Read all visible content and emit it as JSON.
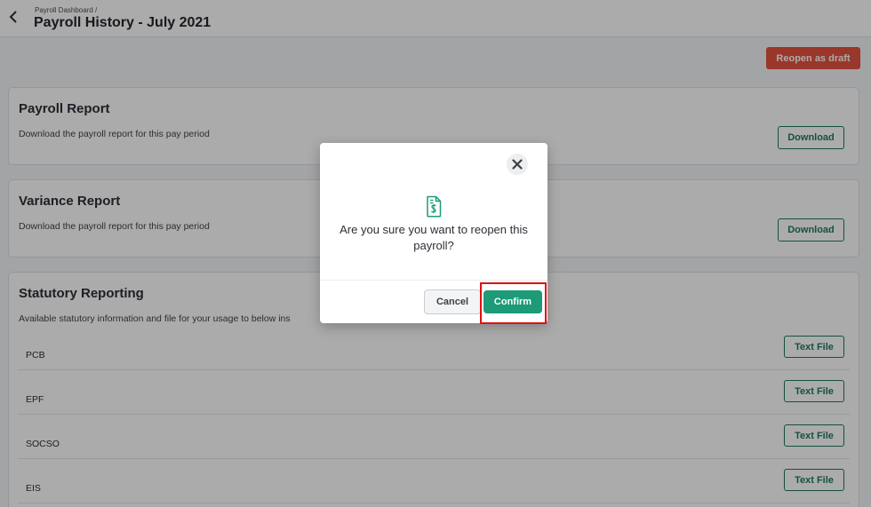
{
  "header": {
    "breadcrumb": "Payroll Dashboard /",
    "title": "Payroll History - July 2021"
  },
  "actions": {
    "reopen_label": "Reopen as draft"
  },
  "cards": {
    "payroll_report": {
      "title": "Payroll Report",
      "description": "Download the payroll report for this pay period",
      "button_label": "Download"
    },
    "variance_report": {
      "title": "Variance Report",
      "description": "Download the payroll report for this pay period",
      "button_label": "Download"
    },
    "statutory": {
      "title": "Statutory Reporting",
      "description": "Available statutory information and file for your usage to below ins",
      "rows": [
        {
          "label": "PCB",
          "button_label": "Text File"
        },
        {
          "label": "EPF",
          "button_label": "Text File"
        },
        {
          "label": "SOCSO",
          "button_label": "Text File"
        },
        {
          "label": "EIS",
          "button_label": "Text File"
        }
      ]
    }
  },
  "modal": {
    "message": "Are you sure you want to reopen this payroll?",
    "cancel_label": "Cancel",
    "confirm_label": "Confirm",
    "icons": {
      "close": "close-icon",
      "document": "document-dollar-icon"
    }
  },
  "colors": {
    "accent": "#1d9a78",
    "danger": "#e5533f",
    "highlight": "#e01010"
  }
}
